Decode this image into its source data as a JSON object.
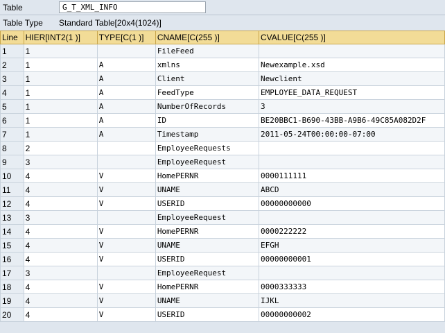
{
  "header": {
    "table_label": "Table",
    "table_value": "G_T_XML_INFO",
    "type_label": "Table Type",
    "type_value": "Standard Table[20x4(1024)]"
  },
  "columns": [
    "Line",
    "HIER[INT2(1 )]",
    "TYPE[C(1 )]",
    "CNAME[C(255 )]",
    "CVALUE[C(255 )]"
  ],
  "rows": [
    {
      "line": "1",
      "hier": "1",
      "type": "",
      "cname": "FileFeed",
      "cvalue": ""
    },
    {
      "line": "2",
      "hier": "1",
      "type": "A",
      "cname": "xmlns",
      "cvalue": "Newexample.xsd"
    },
    {
      "line": "3",
      "hier": "1",
      "type": "A",
      "cname": "Client",
      "cvalue": "Newclient"
    },
    {
      "line": "4",
      "hier": "1",
      "type": "A",
      "cname": "FeedType",
      "cvalue": "EMPLOYEE_DATA_REQUEST"
    },
    {
      "line": "5",
      "hier": "1",
      "type": "A",
      "cname": "NumberOfRecords",
      "cvalue": "3"
    },
    {
      "line": "6",
      "hier": "1",
      "type": "A",
      "cname": "ID",
      "cvalue": "BE20BBC1-B690-43BB-A9B6-49C85A082D2F"
    },
    {
      "line": "7",
      "hier": "1",
      "type": "A",
      "cname": "Timestamp",
      "cvalue": "2011-05-24T00:00:00-07:00"
    },
    {
      "line": "8",
      "hier": "2",
      "type": "",
      "cname": "EmployeeRequests",
      "cvalue": ""
    },
    {
      "line": "9",
      "hier": "3",
      "type": "",
      "cname": "EmployeeRequest",
      "cvalue": ""
    },
    {
      "line": "10",
      "hier": "4",
      "type": "V",
      "cname": "HomePERNR",
      "cvalue": "0000111111"
    },
    {
      "line": "11",
      "hier": "4",
      "type": "V",
      "cname": "UNAME",
      "cvalue": "ABCD"
    },
    {
      "line": "12",
      "hier": "4",
      "type": "V",
      "cname": "USERID",
      "cvalue": "00000000000"
    },
    {
      "line": "13",
      "hier": "3",
      "type": "",
      "cname": "EmployeeRequest",
      "cvalue": ""
    },
    {
      "line": "14",
      "hier": "4",
      "type": "V",
      "cname": "HomePERNR",
      "cvalue": "0000222222"
    },
    {
      "line": "15",
      "hier": "4",
      "type": "V",
      "cname": "UNAME",
      "cvalue": "EFGH"
    },
    {
      "line": "16",
      "hier": "4",
      "type": "V",
      "cname": "USERID",
      "cvalue": "00000000001"
    },
    {
      "line": "17",
      "hier": "3",
      "type": "",
      "cname": "EmployeeRequest",
      "cvalue": ""
    },
    {
      "line": "18",
      "hier": "4",
      "type": "V",
      "cname": "HomePERNR",
      "cvalue": "0000333333"
    },
    {
      "line": "19",
      "hier": "4",
      "type": "V",
      "cname": "UNAME",
      "cvalue": "IJKL"
    },
    {
      "line": "20",
      "hier": "4",
      "type": "V",
      "cname": "USERID",
      "cvalue": "00000000002"
    }
  ]
}
